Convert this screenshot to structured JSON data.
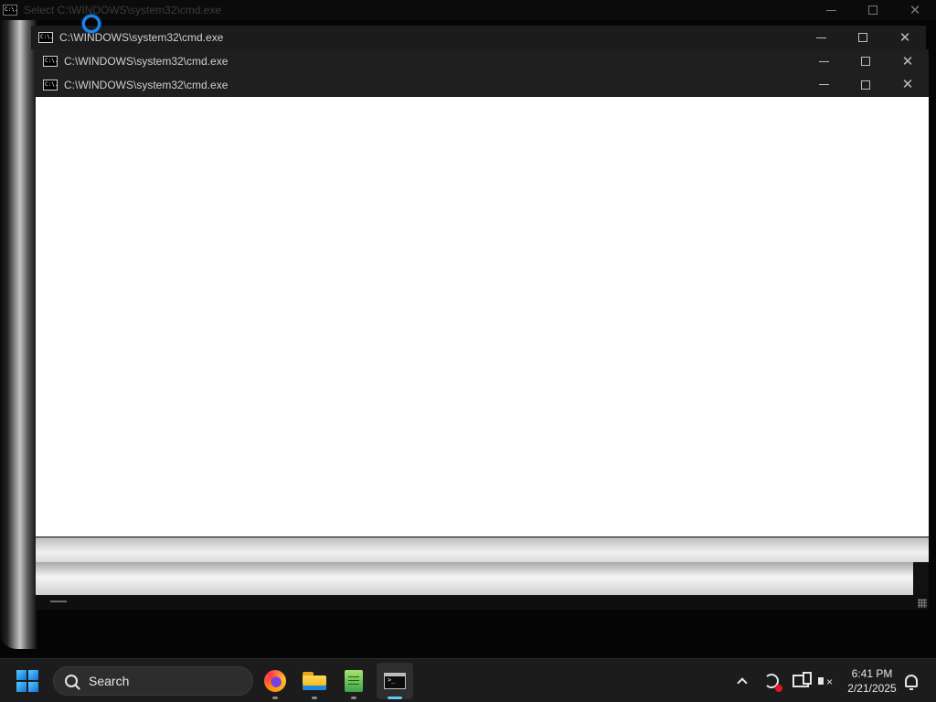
{
  "windows": {
    "top": {
      "title": "Select C:\\WINDOWS\\system32\\cmd.exe"
    },
    "w1": {
      "title": "C:\\WINDOWS\\system32\\cmd.exe"
    },
    "w2": {
      "title": "C:\\WINDOWS\\system32\\cmd.exe"
    },
    "w3": {
      "title": "C:\\WINDOWS\\system32\\cmd.exe"
    },
    "icon_text": "C:\\."
  },
  "taskbar": {
    "search_label": "Search",
    "apps": [
      "firefox-icon",
      "file-explorer-icon",
      "notepad-plus-plus-icon",
      "command-prompt-icon"
    ],
    "active_app": "command-prompt-icon",
    "accent": "#5ec8ff"
  },
  "tray": {
    "time": "6:41 PM",
    "date": "2/21/2025"
  }
}
